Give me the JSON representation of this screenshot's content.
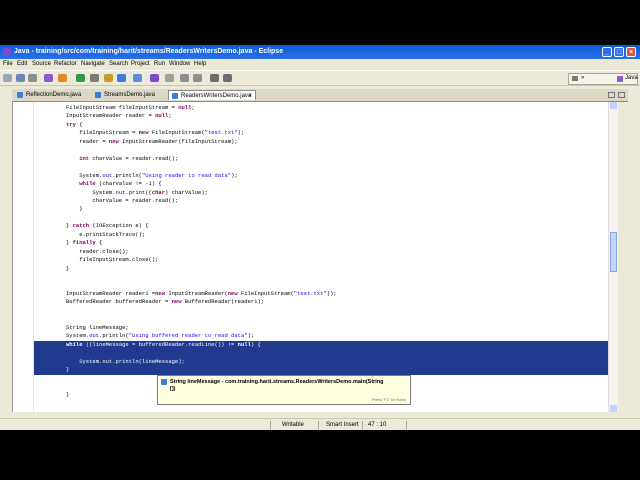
{
  "window": {
    "title": "Java - training/src/com/training/harit/streams/ReadersWritersDemo.java - Eclipse",
    "minimize": "_",
    "maximize": "□",
    "close": "×"
  },
  "menu": [
    "File",
    "Edit",
    "Source",
    "Refactor",
    "Navigate",
    "Search",
    "Project",
    "Run",
    "Window",
    "Help"
  ],
  "perspective": {
    "label": "Java",
    "chevron": "»"
  },
  "tabs": [
    {
      "label": "ReflectionDemo.java",
      "active": false
    },
    {
      "label": "StreamsDemo.java",
      "active": false
    },
    {
      "label": "ReadersWritersDemo.java",
      "active": true
    }
  ],
  "tab_close": "×",
  "code": [
    {
      "segs": [
        {
          "t": "FileInputStream fileInputStream = "
        },
        {
          "t": "null",
          "c": "kw"
        },
        {
          "t": ";"
        }
      ]
    },
    {
      "segs": [
        {
          "t": "InputStreamReader reader = "
        },
        {
          "t": "null",
          "c": "kw"
        },
        {
          "t": ";"
        }
      ]
    },
    {
      "segs": [
        {
          "t": "try",
          "c": "kw"
        },
        {
          "t": " {"
        }
      ]
    },
    {
      "segs": [
        {
          "t": "    fileInputStream = "
        },
        {
          "t": "new",
          "c": "kw"
        },
        {
          "t": " FileInputStream("
        },
        {
          "t": "\"test.txt\"",
          "c": "str"
        },
        {
          "t": ");"
        }
      ]
    },
    {
      "segs": [
        {
          "t": "    reader = "
        },
        {
          "t": "new",
          "c": "kw"
        },
        {
          "t": " InputStreamReader(fileInputStream);"
        }
      ]
    },
    {
      "segs": []
    },
    {
      "segs": [
        {
          "t": "    "
        },
        {
          "t": "int",
          "c": "kw"
        },
        {
          "t": " charValue = reader.read();"
        }
      ]
    },
    {
      "segs": []
    },
    {
      "segs": [
        {
          "t": "    System."
        },
        {
          "t": "out",
          "c": "fld"
        },
        {
          "t": ".println("
        },
        {
          "t": "\"Using reader to read data\"",
          "c": "str"
        },
        {
          "t": ");"
        }
      ]
    },
    {
      "segs": [
        {
          "t": "    "
        },
        {
          "t": "while",
          "c": "kw"
        },
        {
          "t": " (charValue != -1) {"
        }
      ]
    },
    {
      "segs": [
        {
          "t": "        System."
        },
        {
          "t": "out",
          "c": "fld"
        },
        {
          "t": ".print(("
        },
        {
          "t": "char",
          "c": "kw"
        },
        {
          "t": ") charValue);"
        }
      ]
    },
    {
      "segs": [
        {
          "t": "        charValue = reader.read();"
        }
      ]
    },
    {
      "segs": [
        {
          "t": "    }"
        }
      ]
    },
    {
      "segs": []
    },
    {
      "segs": [
        {
          "t": "} "
        },
        {
          "t": "catch",
          "c": "kw"
        },
        {
          "t": " (IOException e) {"
        }
      ]
    },
    {
      "segs": [
        {
          "t": "    e.printStackTrace();"
        }
      ]
    },
    {
      "segs": [
        {
          "t": "} "
        },
        {
          "t": "finally",
          "c": "kw"
        },
        {
          "t": " {"
        }
      ]
    },
    {
      "segs": [
        {
          "t": "    reader.close();"
        }
      ]
    },
    {
      "segs": [
        {
          "t": "    fileInputStream.close();"
        }
      ]
    },
    {
      "segs": [
        {
          "t": "}"
        }
      ]
    },
    {
      "segs": []
    },
    {
      "segs": []
    },
    {
      "segs": [
        {
          "t": "InputStreamReader reader1 ="
        },
        {
          "t": "new",
          "c": "kw"
        },
        {
          "t": " InputStreamReader("
        },
        {
          "t": "new",
          "c": "kw"
        },
        {
          "t": " FileInputStream("
        },
        {
          "t": "\"test.txt\"",
          "c": "str"
        },
        {
          "t": "));"
        }
      ]
    },
    {
      "segs": [
        {
          "t": "BufferedReader bufferedReader = "
        },
        {
          "t": "new",
          "c": "kw"
        },
        {
          "t": " BufferedReader(reader1);"
        }
      ]
    },
    {
      "segs": []
    },
    {
      "segs": []
    },
    {
      "segs": [
        {
          "t": "String lineMessage;"
        }
      ]
    },
    {
      "segs": [
        {
          "t": "System."
        },
        {
          "t": "out",
          "c": "fld"
        },
        {
          "t": ".println("
        },
        {
          "t": "\"Using buffered reader to read data\"",
          "c": "str"
        },
        {
          "t": ");"
        }
      ]
    },
    {
      "segs": [
        {
          "t": "while",
          "c": "kw"
        },
        {
          "t": " ((lineMessage = bufferedReader.readLine()) != "
        },
        {
          "t": "null",
          "c": "kw"
        },
        {
          "t": ") {"
        }
      ],
      "sel": true
    },
    {
      "segs": [],
      "sel": true
    },
    {
      "segs": [
        {
          "t": "    System."
        },
        {
          "t": "out",
          "c": "fld"
        },
        {
          "t": ".println(lineMessage);"
        }
      ],
      "sel": true
    },
    {
      "segs": [
        {
          "t": "}"
        }
      ],
      "sel": true
    },
    {
      "segs": []
    },
    {
      "segs": []
    },
    {
      "segs": [
        {
          "t": "}"
        }
      ]
    }
  ],
  "hover": {
    "text": "String lineMessage - com.training.harit.streams.ReadersWritersDemo.main(String",
    "cont": "[])",
    "footer": "Press 'F2' for focus"
  },
  "status": {
    "mode": "Writable",
    "insert": "Smart Insert",
    "position": "47 : 10"
  }
}
